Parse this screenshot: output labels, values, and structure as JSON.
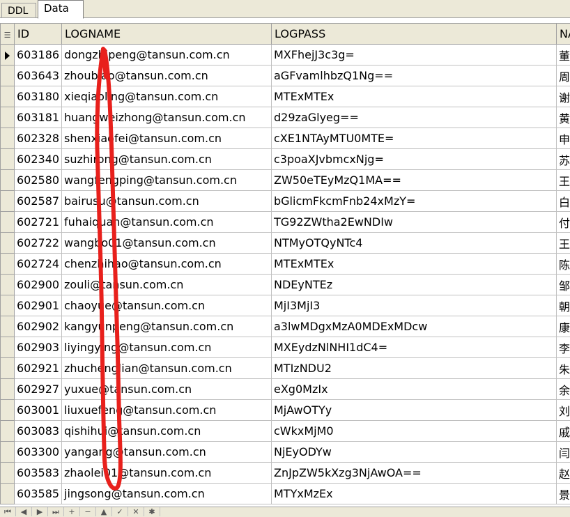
{
  "tabs": [
    "DDL",
    "Data"
  ],
  "columns": [
    "ID",
    "LOGNAME",
    "LOGPASS",
    "NA"
  ],
  "rows": [
    {
      "id": "603186",
      "logname": "dongzhipeng@tansun.com.cn",
      "logpass": "MXFhejJ3c3g=",
      "na": "董"
    },
    {
      "id": "603643",
      "logname": "zhoubiao@tansun.com.cn",
      "logpass": "aGFvamlhbzQ1Ng==",
      "na": "周"
    },
    {
      "id": "603180",
      "logname": "xieqiaoling@tansun.com.cn",
      "logpass": "MTExMTEx",
      "na": "谢"
    },
    {
      "id": "603181",
      "logname": "huangweizhong@tansun.com.cn",
      "logpass": "d29zaGlyeg==",
      "na": "黄"
    },
    {
      "id": "602328",
      "logname": "shenxiaofei@tansun.com.cn",
      "logpass": "cXE1NTAyMTU0MTE=",
      "na": "申"
    },
    {
      "id": "602340",
      "logname": "suzhirong@tansun.com.cn",
      "logpass": "c3poaXJvbmcxNjg=",
      "na": "苏"
    },
    {
      "id": "602580",
      "logname": "wangfengping@tansun.com.cn",
      "logpass": "ZW50eTEyMzQ1MA==",
      "na": "王"
    },
    {
      "id": "602587",
      "logname": "bairusu@tansun.com.cn",
      "logpass": "bGlicmFkcmFnb24xMzY=",
      "na": "白"
    },
    {
      "id": "602721",
      "logname": "fuhaiquan@tansun.com.cn",
      "logpass": "TG92ZWtha2EwNDIw",
      "na": "付"
    },
    {
      "id": "602722",
      "logname": "wangbo01@tansun.com.cn",
      "logpass": "NTMyOTQyNTc4",
      "na": "王"
    },
    {
      "id": "602724",
      "logname": "chenzhihao@tansun.com.cn",
      "logpass": "MTExMTEx",
      "na": "陈"
    },
    {
      "id": "602900",
      "logname": "zouli@tansun.com.cn",
      "logpass": "NDEyNTEz",
      "na": "邹"
    },
    {
      "id": "602901",
      "logname": "chaoyue@tansun.com.cn",
      "logpass": "MjI3MjI3",
      "na": "朝"
    },
    {
      "id": "602902",
      "logname": "kangyunpeng@tansun.com.cn",
      "logpass": "a3lwMDgxMzA0MDExMDcw",
      "na": "康"
    },
    {
      "id": "602903",
      "logname": "liyingying@tansun.com.cn",
      "logpass": "MXEydzNlNHI1dC4=",
      "na": "李"
    },
    {
      "id": "602921",
      "logname": "zhuchenglian@tansun.com.cn",
      "logpass": "MTIzNDU2",
      "na": "朱"
    },
    {
      "id": "602927",
      "logname": "yuxue@tansun.com.cn",
      "logpass": "eXg0MzIx",
      "na": "余"
    },
    {
      "id": "603001",
      "logname": "liuxuefeng@tansun.com.cn",
      "logpass": "MjAwOTYy",
      "na": "刘"
    },
    {
      "id": "603083",
      "logname": "qishihui@tansun.com.cn",
      "logpass": "cWkxMjM0",
      "na": "戚"
    },
    {
      "id": "603300",
      "logname": "yangang@tansun.com.cn",
      "logpass": "NjEyODYw",
      "na": "闫"
    },
    {
      "id": "603583",
      "logname": "zhaolei01@tansun.com.cn",
      "logpass": "ZnJpZW5kXzg3NjAwOA==",
      "na": "赵"
    },
    {
      "id": "603585",
      "logname": "jingsong@tansun.com.cn",
      "logpass": "MTYxMzEx",
      "na": "景"
    }
  ],
  "colors": {
    "annotation": "#e8201c",
    "header_bg": "#ece9d8"
  },
  "icons": [
    "row-indicator-arrow-icon",
    "grid-menu-icon",
    "first-record-icon",
    "prior-record-icon",
    "next-record-icon",
    "last-record-icon",
    "insert-record-icon",
    "delete-record-icon",
    "edit-record-icon",
    "post-edit-icon",
    "cancel-edit-icon",
    "refresh-icon"
  ]
}
